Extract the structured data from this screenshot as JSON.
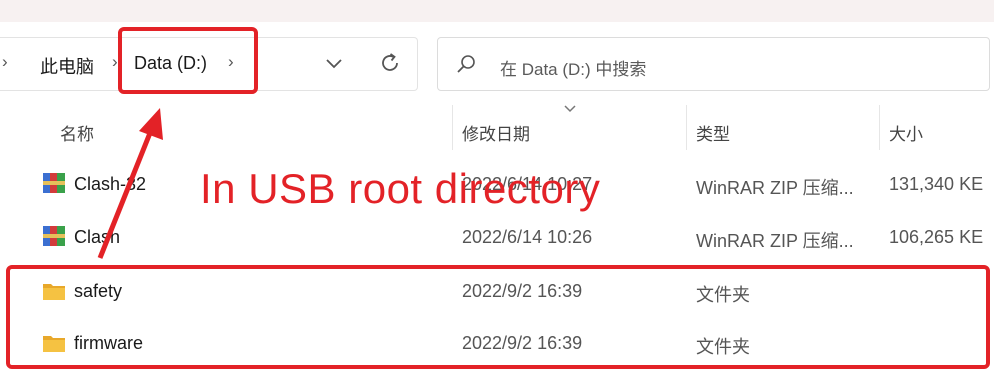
{
  "address_bar": {
    "crumbs": [
      "此电脑",
      "Data (D:)"
    ]
  },
  "search": {
    "placeholder": "在 Data (D:) 中搜索"
  },
  "columns": {
    "name": "名称",
    "modified": "修改日期",
    "type": "类型",
    "size": "大小"
  },
  "rows": [
    {
      "name": "Clash-32",
      "modified": "2022/6/14 10:27",
      "type": "WinRAR ZIP 压缩...",
      "size": "131,340 KE",
      "icon": "winrar-zip-icon"
    },
    {
      "name": "Clash",
      "modified": "2022/6/14 10:26",
      "type": "WinRAR ZIP 压缩...",
      "size": "106,265 KE",
      "icon": "winrar-zip-icon"
    },
    {
      "name": "safety",
      "modified": "2022/9/2 16:39",
      "type": "文件夹",
      "size": "",
      "icon": "folder-icon"
    },
    {
      "name": "firmware",
      "modified": "2022/9/2 16:39",
      "type": "文件夹",
      "size": "",
      "icon": "folder-icon"
    }
  ],
  "annotation": {
    "text": "In USB root directory"
  },
  "colors": {
    "annotation_red": "#e32227",
    "folder_yellow": "#f5c242"
  }
}
